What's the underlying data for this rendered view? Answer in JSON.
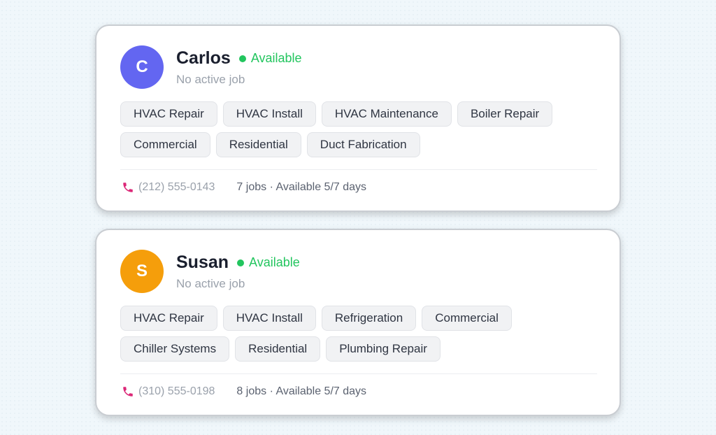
{
  "technicians": [
    {
      "initial": "C",
      "avatar_color": "#6366f1",
      "name": "Carlos",
      "status": "Available",
      "subtitle": "No active job",
      "tags": [
        "HVAC Repair",
        "HVAC Install",
        "HVAC Maintenance",
        "Boiler Repair",
        "Commercial",
        "Residential",
        "Duct Fabrication"
      ],
      "phone": "(212) 555-0143",
      "meta": "7 jobs · Available 5/7 days"
    },
    {
      "initial": "S",
      "avatar_color": "#f59e0b",
      "name": "Susan",
      "status": "Available",
      "subtitle": "No active job",
      "tags": [
        "HVAC Repair",
        "HVAC Install",
        "Refrigeration",
        "Commercial",
        "Chiller Systems",
        "Residential",
        "Plumbing Repair"
      ],
      "phone": "(310) 555-0198",
      "meta": "8 jobs · Available 5/7 days"
    }
  ],
  "colors": {
    "status_green": "#22c55e",
    "phone_icon": "#db2777"
  },
  "icons": {
    "phone": "phone-icon"
  }
}
